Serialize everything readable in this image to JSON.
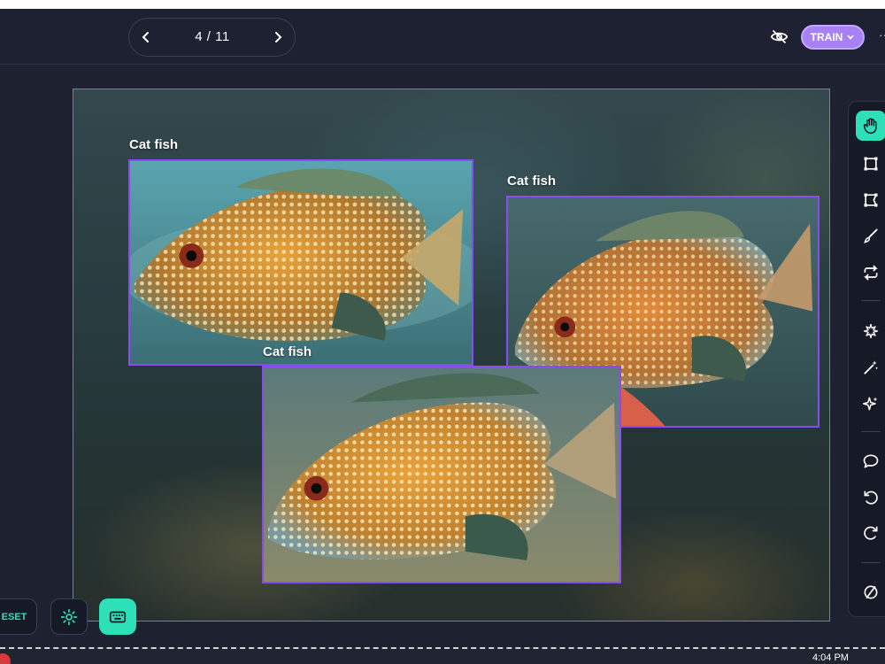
{
  "pager": {
    "counter": "4 / 11"
  },
  "header": {
    "train_label": "TRAIN",
    "more_label": "···"
  },
  "annotations": [
    {
      "label": "Cat fish"
    },
    {
      "label": "Cat fish"
    },
    {
      "label": "Cat fish"
    }
  ],
  "toolbar": {
    "tools": [
      "hand-icon",
      "bounding-box-icon",
      "polygon-icon",
      "brush-icon",
      "convert-icon",
      "auto-segment-icon",
      "magic-wand-icon",
      "sparkle-icon",
      "comment-icon",
      "undo-icon",
      "redo-icon",
      "clear-icon"
    ]
  },
  "bottom": {
    "reset_label": "ESET"
  },
  "taskbar": {
    "time": "4:04 PM"
  },
  "colors": {
    "accent": "#2de0b8",
    "bbox": "#8a4cf0",
    "train": "#a882f5",
    "bg": "#1e2230"
  }
}
